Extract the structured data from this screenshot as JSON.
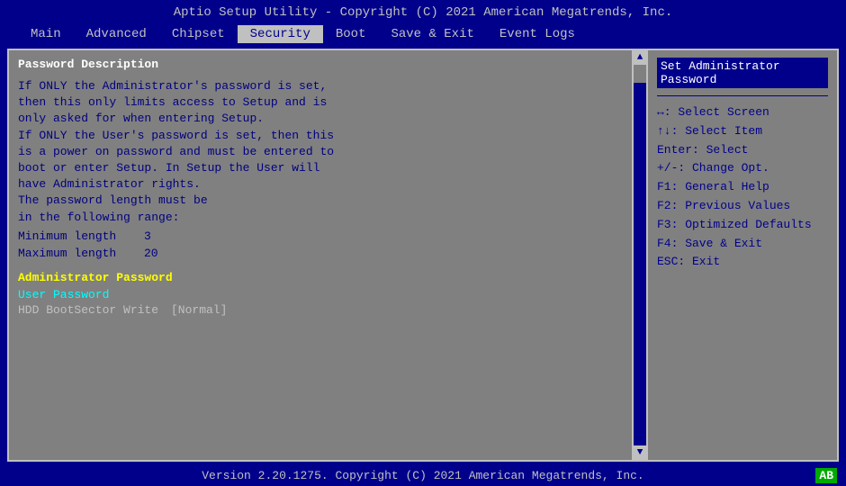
{
  "title": "Aptio Setup Utility - Copyright (C) 2021 American Megatrends, Inc.",
  "menu": {
    "items": [
      {
        "id": "main",
        "label": "Main",
        "active": false
      },
      {
        "id": "advanced",
        "label": "Advanced",
        "active": false
      },
      {
        "id": "chipset",
        "label": "Chipset",
        "active": false
      },
      {
        "id": "security",
        "label": "Security",
        "active": true
      },
      {
        "id": "boot",
        "label": "Boot",
        "active": false
      },
      {
        "id": "save-exit",
        "label": "Save & Exit",
        "active": false
      },
      {
        "id": "event-logs",
        "label": "Event Logs",
        "active": false
      }
    ]
  },
  "left_panel": {
    "title": "Password Description",
    "description_lines": [
      "If ONLY the Administrator's password is set,",
      "then this only limits access to Setup and is",
      "only asked for when entering Setup.",
      "If ONLY the User's password is set, then this",
      "is a power on password and must be entered to",
      "boot or enter Setup. In Setup the User will",
      "have Administrator rights.",
      "The password length must be",
      "in the following range:"
    ],
    "min_length_label": "Minimum length",
    "min_length_value": "3",
    "max_length_label": "Maximum length",
    "max_length_value": "20",
    "section_header": "Administrator Password",
    "user_password_label": "User Password",
    "hdd_label": "HDD BootSector Write",
    "hdd_value": "[Normal]"
  },
  "right_panel": {
    "selected_line1": "Set Administrator",
    "selected_line2": "Password",
    "help_items": [
      "↔: Select Screen",
      "↑↓: Select Item",
      "Enter: Select",
      "+/-: Change Opt.",
      "F1: General Help",
      "F2: Previous Values",
      "F3: Optimized Defaults",
      "F4: Save & Exit",
      "ESC: Exit"
    ]
  },
  "status_bar": {
    "text": "Version 2.20.1275. Copyright (C) 2021 American Megatrends, Inc.",
    "badge": "AB"
  }
}
